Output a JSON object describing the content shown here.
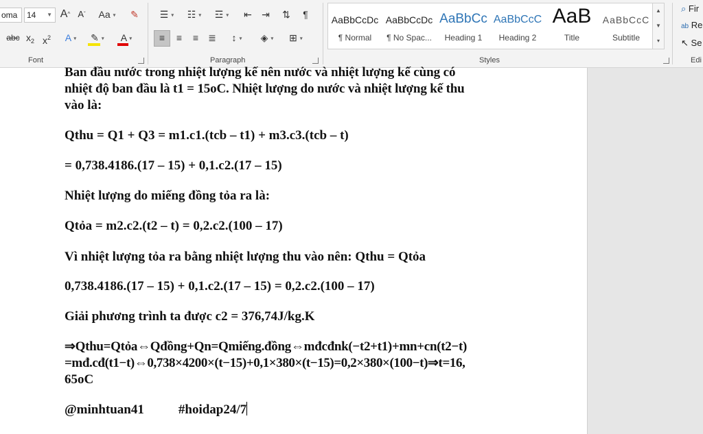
{
  "ribbon": {
    "font": {
      "font_name": "oma",
      "font_size": "14",
      "group_label": "Font"
    },
    "paragraph": {
      "group_label": "Paragraph"
    },
    "styles": {
      "group_label": "Styles",
      "items": [
        {
          "sample": "AaBbCcDc",
          "name": "¶ Normal"
        },
        {
          "sample": "AaBbCcDc",
          "name": "¶ No Spac..."
        },
        {
          "sample": "AaBbCc",
          "name": "Heading 1"
        },
        {
          "sample": "AaBbCcC",
          "name": "Heading 2"
        },
        {
          "sample": "AaB",
          "name": "Title"
        },
        {
          "sample": "AaBbCcC",
          "name": "Subtitle"
        }
      ]
    },
    "editing": {
      "group_label": "Edi",
      "find": "Fir",
      "replace": "Re",
      "select": "Se"
    }
  },
  "document": {
    "paragraphs": [
      "Ban đầu nước trong nhiệt lượng kế nên nước và nhiệt lượng kế cùng có",
      "nhiệt độ ban đầu là t1 = 15oC. Nhiệt lượng do nước và nhiệt lượng kế thu",
      "vào là:",
      "Qthu = Q1 + Q3 = m1.c1.(tcb – t1) + m3.c3.(tcb – t)",
      "= 0,738.4186.(17 – 15) + 0,1.c2.(17 – 15)",
      "Nhiệt lượng do miếng đồng tỏa ra là:",
      "Qtỏa = m2.c2.(t2 – t) = 0,2.c2.(100 – 17)",
      "Vì nhiệt lượng tỏa ra bằng nhiệt lượng thu vào nên: Qthu = Qtỏa",
      "0,738.4186.(17 – 15) + 0,1.c2.(17 – 15) = 0,2.c2.(100 – 17)",
      "Giải phương trình ta được c2 = 376,74J/kg.K",
      "⇒Qthu=Qtỏa⇔Qđồng+Qn=Qmiếng.đồng⇔mđcđnk(−t2+t1)+mn+cn(t2−t)",
      "=mđ.cđ(t1−t)⇔0,738×4200×(t−15)+0,1×380×(t−15)=0,2×380×(100−t)⇒t=16,",
      "65oC"
    ],
    "signature": "@minhtuan41",
    "tag": "#hoidap24/7"
  }
}
